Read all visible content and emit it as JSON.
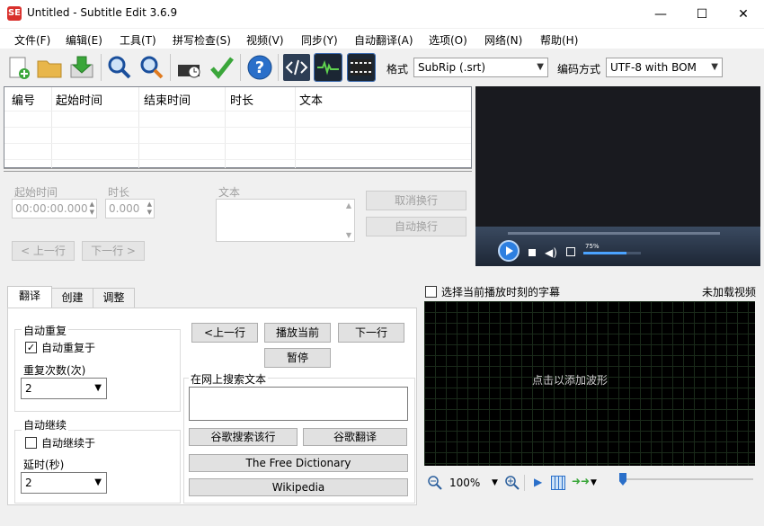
{
  "window": {
    "title": "Untitled - Subtitle Edit 3.6.9",
    "logo_text": "SE",
    "minimize": "—",
    "maximize": "☐",
    "close": "✕"
  },
  "menu": [
    "文件(F)",
    "编辑(E)",
    "工具(T)",
    "拼写检查(S)",
    "视频(V)",
    "同步(Y)",
    "自动翻译(A)",
    "选项(O)",
    "网络(N)",
    "帮助(H)"
  ],
  "toolbar": {
    "icons": [
      "new-file-icon",
      "open-folder-icon",
      "save-icon",
      "find-icon",
      "replace-icon",
      "fix-errors-icon",
      "spell-check-icon",
      "help-icon",
      "source-view-icon",
      "waveform-icon",
      "video-frame-icon"
    ],
    "format_label": "格式",
    "format_value": "SubRip (.srt)",
    "encoding_label": "编码方式",
    "encoding_value": "UTF-8 with BOM"
  },
  "grid": {
    "columns": [
      "编号",
      "起始时间",
      "结束时间",
      "时长",
      "文本"
    ]
  },
  "editor": {
    "start_label": "起始时间",
    "start_value": "00:00:00.000",
    "duration_label": "时长",
    "duration_value": "0.000",
    "text_label": "文本",
    "cancel_wrap": "取消换行",
    "auto_wrap": "自动换行",
    "prev_line": "< 上一行",
    "next_line": "下一行 >"
  },
  "video": {
    "volume": "75%"
  },
  "tabs": [
    "翻译",
    "创建",
    "调整"
  ],
  "translate": {
    "auto_repeat_group": "自动重复",
    "auto_repeat_on": "自动重复于",
    "repeat_count_label": "重复次数(次)",
    "repeat_count": "2",
    "auto_continue_group": "自动继续",
    "auto_continue_on": "自动继续于",
    "delay_label": "延时(秒)",
    "delay": "2",
    "prev": "<上一行",
    "play_current": "播放当前",
    "next": "下一行",
    "pause": "暂停",
    "search_group": "在网上搜索文本",
    "google_search": "谷歌搜索该行",
    "google_translate": "谷歌翻译",
    "free_dictionary": "The Free Dictionary",
    "wikipedia": "Wikipedia"
  },
  "waveform": {
    "select_current": "选择当前播放时刻的字幕",
    "no_video": "未加载视频",
    "hint": "点击以添加波形",
    "zoom": "100%"
  }
}
